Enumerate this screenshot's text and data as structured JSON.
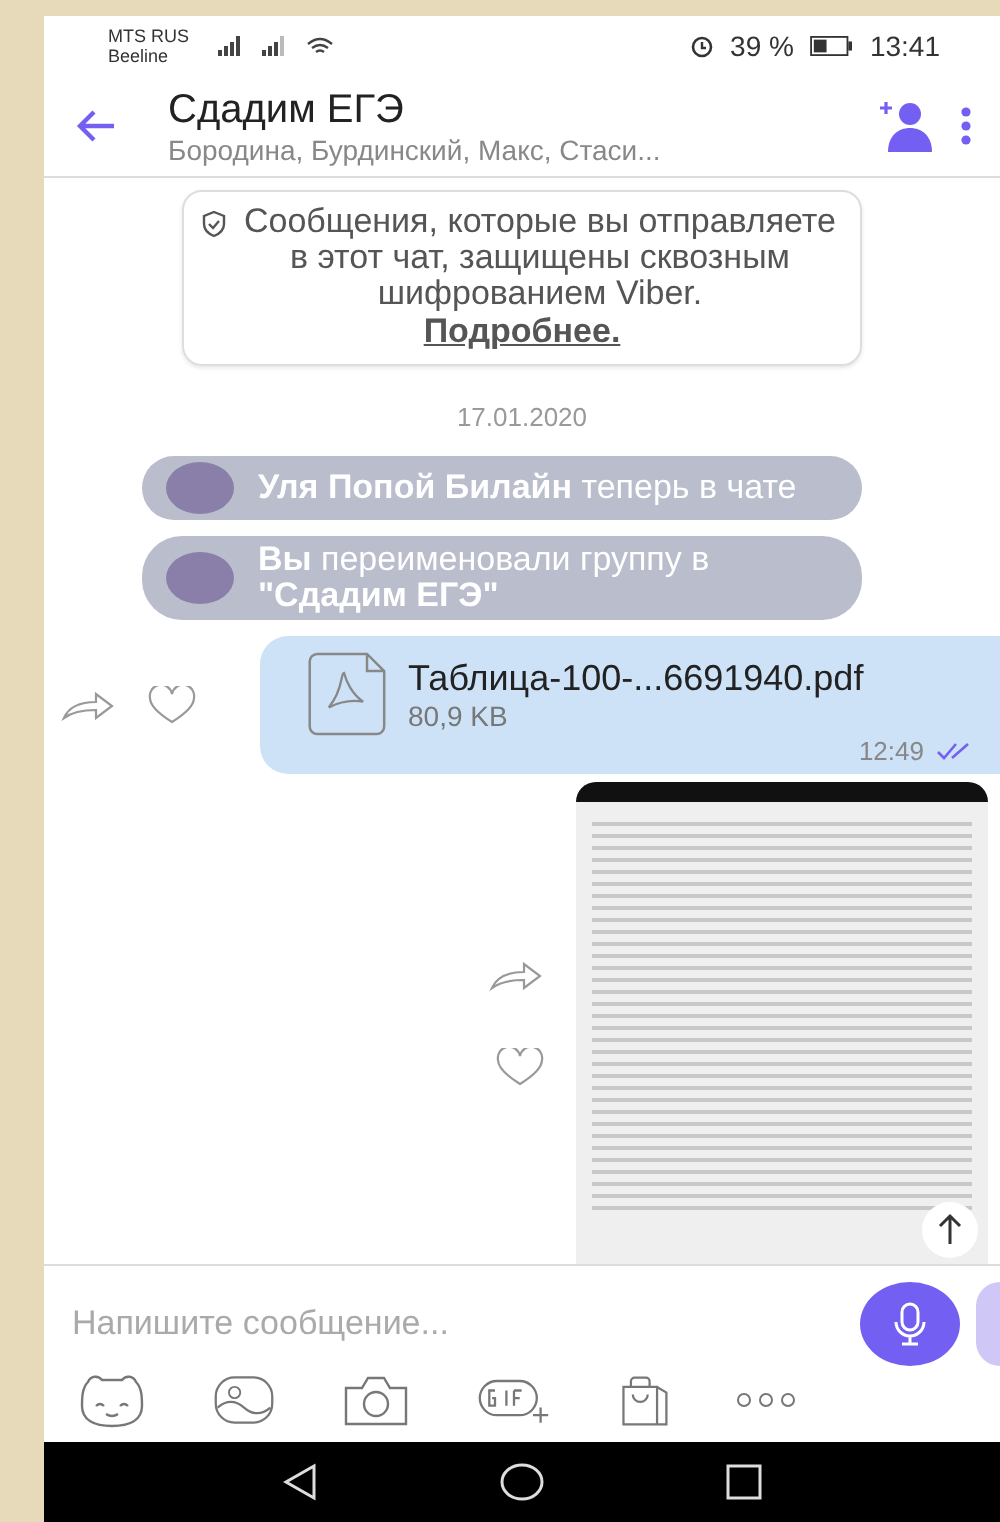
{
  "status_bar": {
    "carrier_1": "MTS RUS",
    "carrier_2": "Beeline",
    "battery": "39 %",
    "time": "13:41"
  },
  "header": {
    "title": "Сдадим ЕГЭ",
    "subtitle": "Бородина, Бурдинский, Макс, Стаси..."
  },
  "encryption_notice": {
    "text": "Сообщения, которые вы отправляете в этот чат, защищены сквозным шифрованием Viber.",
    "link": "Подробнее."
  },
  "date": "17.01.2020",
  "events": [
    {
      "text": "**Уля Попой Билайн** теперь в чате"
    },
    {
      "text": "**Вы** переименовали группу в **\"Сдадим ЕГЭ\"**"
    }
  ],
  "file_message": {
    "name": "Таблица-100-...6691940.pdf",
    "size": "80,9 KB",
    "time": "12:49",
    "read": true
  },
  "composer": {
    "placeholder": "Напишите сообщение..."
  }
}
